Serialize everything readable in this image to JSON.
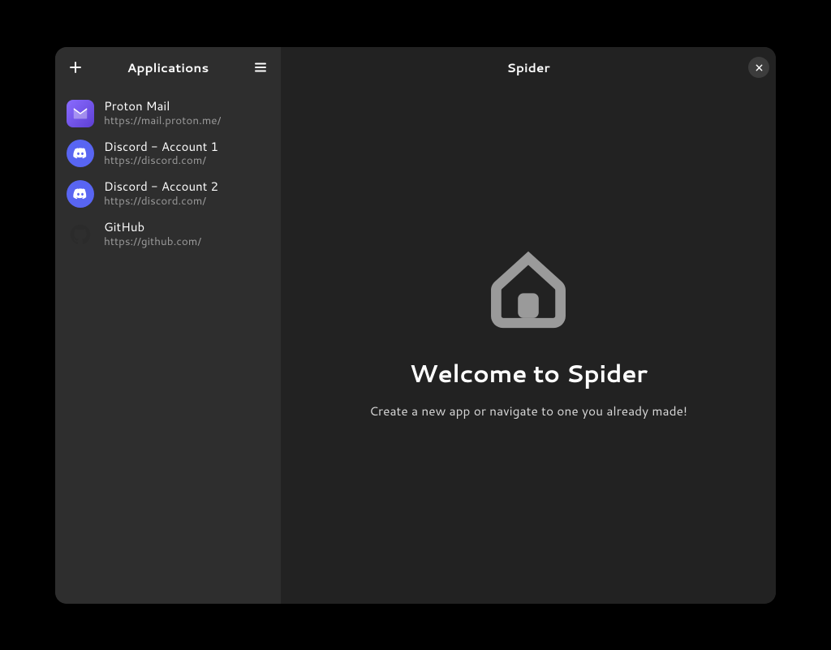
{
  "sidebar": {
    "title": "Applications",
    "items": [
      {
        "name": "Proton Mail",
        "url": "https://mail.proton.me/",
        "icon": "proton-mail-icon"
      },
      {
        "name": "Discord - Account 1",
        "url": "https://discord.com/",
        "icon": "discord-icon"
      },
      {
        "name": "Discord - Account 2",
        "url": "https://discord.com/",
        "icon": "discord-icon"
      },
      {
        "name": "GitHub",
        "url": "https://github.com/",
        "icon": "github-icon"
      }
    ]
  },
  "main": {
    "title": "Spider",
    "welcome_heading": "Welcome to Spider",
    "welcome_sub": "Create a new app or navigate to one you already made!"
  }
}
